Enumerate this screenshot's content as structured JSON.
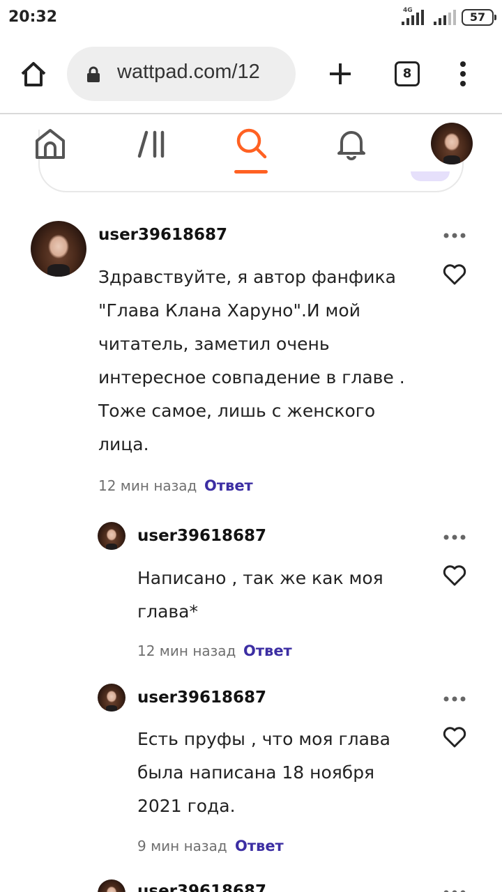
{
  "status_bar": {
    "time": "20:32",
    "network": "4G",
    "battery": "57"
  },
  "browser": {
    "url": "wattpad.com/12",
    "tab_count": "8"
  },
  "app_nav": {
    "active": "search"
  },
  "comments": [
    {
      "username": "user39618687",
      "text": "Здравствуйте, я автор фанфика \"Глава Клана Харуно\".И мой читатель, заметил очень интересное совпадение в главе . Тоже самое, лишь с женского лица.",
      "lines": [
        "Здравствуйте, я автор фанфика",
        "\"Глава Клана Харуно\".И мой",
        "читатель, заметил очень",
        "интересное совпадение в главе .",
        "Тоже самое, лишь с женского",
        "лица."
      ],
      "time": "12 мин назад",
      "reply_label": "Ответ"
    },
    {
      "username": "user39618687",
      "text": "Написано , так же как моя глава*",
      "lines": [
        "Написано , так же как моя",
        "глава*"
      ],
      "time": "12 мин назад",
      "reply_label": "Ответ"
    },
    {
      "username": "user39618687",
      "text": "Есть пруфы , что моя глава была написана 18 ноября 2021 года.",
      "lines": [
        "Есть пруфы , что моя глава",
        "была написана 18 ноября",
        "2021 года."
      ],
      "time": "9 мин назад",
      "reply_label": "Ответ"
    },
    {
      "username": "user39618687"
    }
  ],
  "colors": {
    "accent": "#ff6122",
    "reply": "#3c2ea3",
    "text": "#121212",
    "muted": "#6f6f6f"
  },
  "icons": [
    "home-icon",
    "lock-icon",
    "plus-icon",
    "menu-icon",
    "library-icon",
    "search-icon",
    "bell-icon",
    "more-icon",
    "heart-icon"
  ]
}
